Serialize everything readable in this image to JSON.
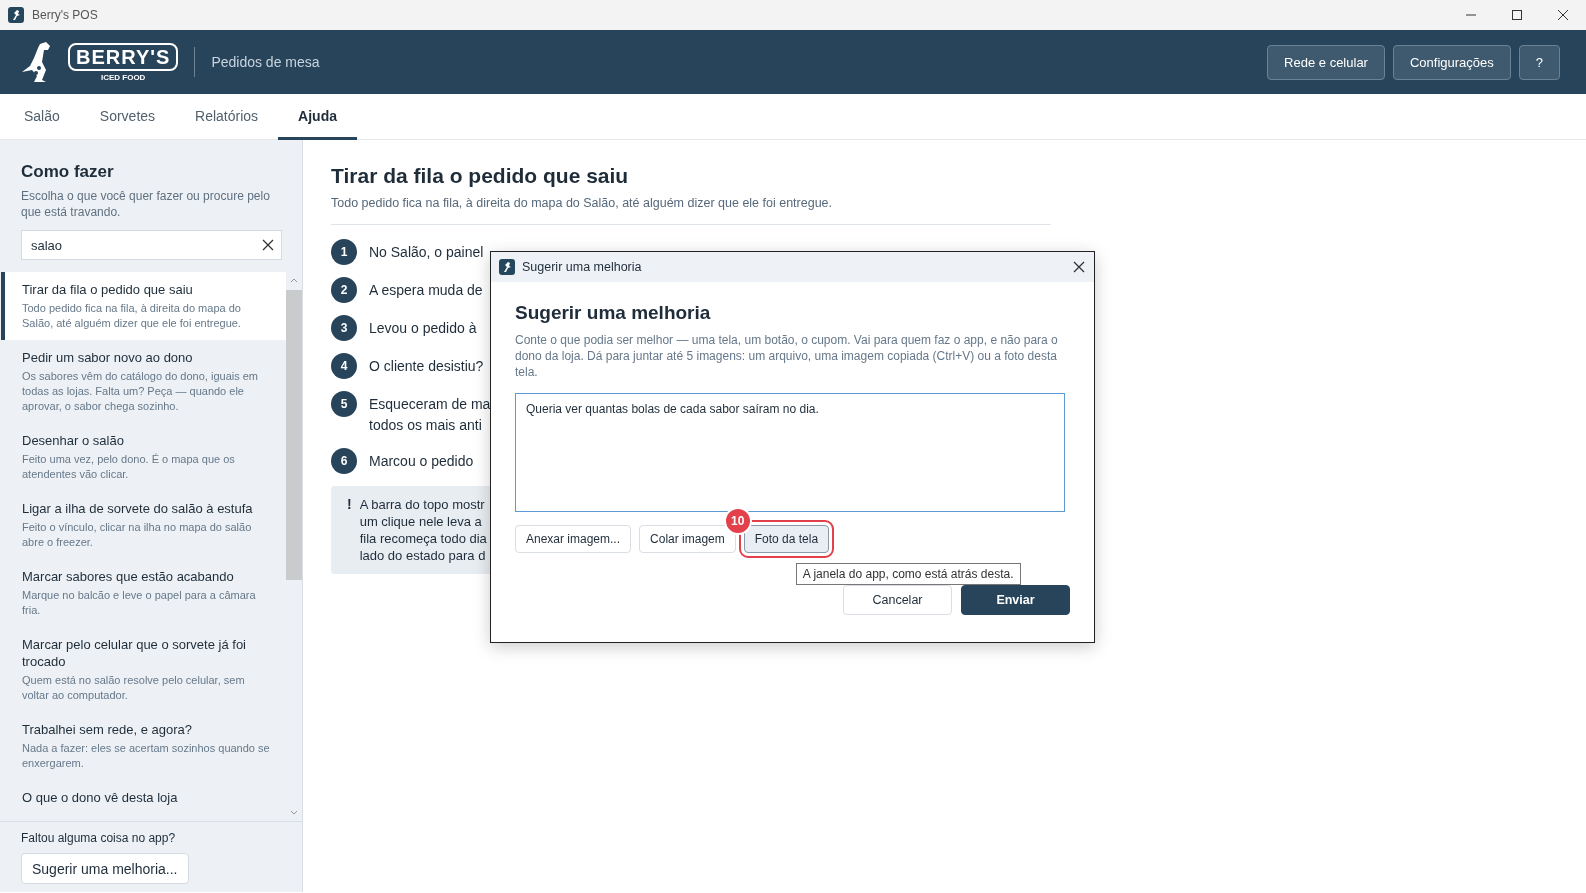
{
  "window": {
    "title": "Berry's POS"
  },
  "header": {
    "logo": {
      "name": "BERRY'S",
      "tagline": "ICED FOOD"
    },
    "section": "Pedidos de mesa",
    "buttons": [
      "Rede e celular",
      "Configurações",
      "?"
    ]
  },
  "tabs": [
    {
      "label": "Salão",
      "selected": false
    },
    {
      "label": "Sorvetes",
      "selected": false
    },
    {
      "label": "Relatórios",
      "selected": false
    },
    {
      "label": "Ajuda",
      "selected": true
    }
  ],
  "sidebar": {
    "title": "Como fazer",
    "description": "Escolha o que você quer fazer ou procure pelo que está travando.",
    "search": {
      "value": "salao"
    },
    "items": [
      {
        "title": "Tirar da fila o pedido que saiu",
        "description": "Todo pedido fica na fila, à direita do mapa do Salão, até alguém dizer que ele foi entregue.",
        "selected": true
      },
      {
        "title": "Pedir um sabor novo ao dono",
        "description": "Os sabores vêm do catálogo do dono, iguais em todas as lojas. Falta um? Peça — quando ele aprovar, o sabor chega sozinho.",
        "selected": false
      },
      {
        "title": "Desenhar o salão",
        "description": "Feito uma vez, pelo dono. É o mapa que os atendentes vão clicar.",
        "selected": false
      },
      {
        "title": "Ligar a ilha de sorvete do salão à estufa",
        "description": "Feito o vínculo, clicar na ilha no mapa do salão abre o freezer.",
        "selected": false
      },
      {
        "title": "Marcar sabores que estão acabando",
        "description": "Marque no balcão e leve o papel para a câmara fria.",
        "selected": false
      },
      {
        "title": "Marcar pelo celular que o sorvete já foi trocado",
        "description": "Quem está no salão resolve pelo celular, sem voltar ao computador.",
        "selected": false
      },
      {
        "title": "Trabalhei sem rede, e agora?",
        "description": "Nada a fazer: eles se acertam sozinhos quando se enxergarem.",
        "selected": false
      },
      {
        "title": "O que o dono vê desta loja",
        "selected": false
      }
    ],
    "footer": {
      "prompt": "Faltou alguma coisa no app?",
      "button": "Sugerir uma melhoria..."
    }
  },
  "article": {
    "title": "Tirar da fila o pedido que saiu",
    "subtitle": "Todo pedido fica na fila, à direita do mapa do Salão, até alguém dizer que ele foi entregue.",
    "steps": [
      {
        "number": "1",
        "lines": [
          "No Salão, o painel"
        ]
      },
      {
        "number": "2",
        "lines": [
          "A espera muda de"
        ]
      },
      {
        "number": "3",
        "lines": [
          "Levou o pedido à"
        ]
      },
      {
        "number": "4",
        "lines": [
          "O cliente desistiu?"
        ]
      },
      {
        "number": "5",
        "lines": [
          "Esqueceram de ma",
          "todos os mais anti"
        ]
      },
      {
        "number": "6",
        "lines": [
          "Marcou o pedido"
        ]
      }
    ],
    "note": {
      "icon": "!",
      "lines": [
        "A barra do topo mostr",
        "um clique nele leva a",
        "fila recomeça todo dia",
        "lado do estado para d"
      ]
    }
  },
  "dialog": {
    "title": "Sugerir uma melhoria",
    "heading": "Sugerir uma melhoria",
    "description": "Conte o que podia ser melhor — uma tela, um botão, o cupom. Vai para quem faz o app, e não para o dono da loja. Dá para juntar até 5 imagens: um arquivo, uma imagem copiada (Ctrl+V) ou a foto desta tela.",
    "message": {
      "value": "Queria ver quantas bolas de cada sabor saíram no dia."
    },
    "attach_buttons": [
      {
        "label": "Anexar imagem...",
        "highlighted": false
      },
      {
        "label": "Colar imagem",
        "highlighted": false
      },
      {
        "label": "Foto da tela",
        "highlighted": true,
        "badge": "10",
        "tooltip": "A janela do app, como está atrás desta."
      }
    ],
    "actions": [
      {
        "label": "Cancelar",
        "kind": "secondary"
      },
      {
        "label": "Enviar",
        "kind": "primary"
      }
    ]
  }
}
